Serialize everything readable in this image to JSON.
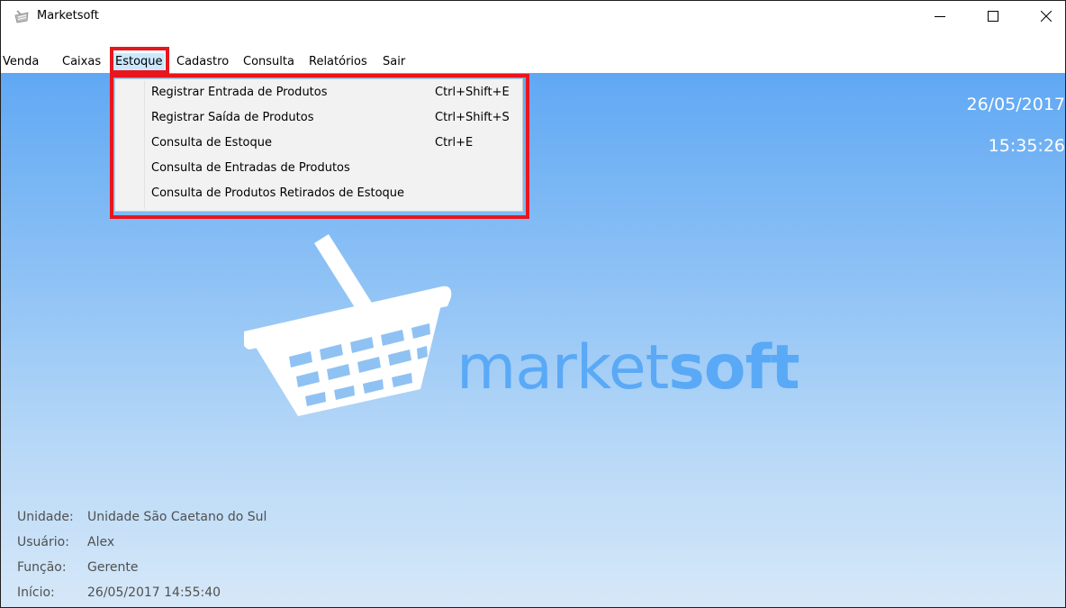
{
  "window": {
    "title": "Marketsoft"
  },
  "menubar": {
    "items": [
      {
        "label": "Venda"
      },
      {
        "label": "Caixas"
      },
      {
        "label": "Estoque"
      },
      {
        "label": "Cadastro"
      },
      {
        "label": "Consulta"
      },
      {
        "label": "Relatórios"
      },
      {
        "label": "Sair"
      }
    ],
    "active": "Estoque"
  },
  "dropdown": {
    "items": [
      {
        "label": "Registrar Entrada de Produtos",
        "shortcut": "Ctrl+Shift+E"
      },
      {
        "label": "Registrar Saída de Produtos",
        "shortcut": "Ctrl+Shift+S"
      },
      {
        "label": "Consulta de Estoque",
        "shortcut": "Ctrl+E"
      },
      {
        "label": "Consulta de Entradas de Produtos",
        "shortcut": ""
      },
      {
        "label": "Consulta de Produtos Retirados de Estoque",
        "shortcut": ""
      }
    ]
  },
  "clock": {
    "date": "26/05/2017",
    "time": "15:35:26"
  },
  "logo": {
    "text_regular": "market",
    "text_bold": "soft",
    "icon": "shopping-basket-icon",
    "color": "#5aa9f7"
  },
  "session": {
    "unidade_label": "Unidade:",
    "unidade": "Unidade São Caetano do Sul",
    "usuario_label": "Usuário:",
    "usuario": "Alex",
    "funcao_label": "Função:",
    "funcao": "Gerente",
    "inicio_label": "Início:",
    "inicio": "26/05/2017 14:55:40"
  },
  "colors": {
    "highlight": "#e8161d",
    "background_top": "#60a8f4",
    "background_bottom": "#d6e8f8"
  }
}
